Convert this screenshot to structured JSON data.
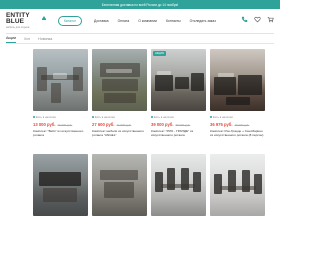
{
  "promo": {
    "text": "Бесплатная доставка по всей России до 14 ноября!"
  },
  "brand": {
    "name": "ENTITY BLUE",
    "tagline": "мебель для отдыха"
  },
  "header": {
    "catalog_label": "Каталог",
    "nav": [
      "Доставка",
      "Оплата",
      "О компании",
      "Контакты",
      "Отследить заказ"
    ],
    "accent_color": "#2fa39a"
  },
  "tabs": [
    {
      "label": "Акции",
      "active": true
    },
    {
      "label": "Хит",
      "active": false
    },
    {
      "label": "Новинка",
      "active": false
    }
  ],
  "products": [
    {
      "stock": "Есть в наличии",
      "price": "13 000 руб.",
      "old_price": "26 000 руб.",
      "title": "Комплект \"Bello\" из искусственного ротанга",
      "badge": ""
    },
    {
      "stock": "Есть в наличии",
      "price": "27 600 руб.",
      "old_price": "41 500 руб.",
      "title": "Комплект мебели из искусственного ротанга \"ANGEL\"",
      "badge": ""
    },
    {
      "stock": "Есть в наличии",
      "price": "39 000 руб.",
      "old_price": "59 000 руб.",
      "title": "Комплект \"РИО - ГРАНДЕ\" из искусственного ротанга",
      "badge": "АКЦИЯ"
    },
    {
      "stock": "Есть в наличии",
      "price": "36 975 руб.",
      "old_price": "49 300 руб.",
      "title": "Комплект Рио-Гранде + Сан-Марино из искусственного ротанга (8 персон)",
      "badge": ""
    },
    {
      "stock": "",
      "price": "",
      "old_price": "",
      "title": "",
      "badge": ""
    },
    {
      "stock": "",
      "price": "",
      "old_price": "",
      "title": "",
      "badge": ""
    },
    {
      "stock": "",
      "price": "",
      "old_price": "",
      "title": "",
      "badge": ""
    },
    {
      "stock": "",
      "price": "",
      "old_price": "",
      "title": "",
      "badge": ""
    }
  ]
}
